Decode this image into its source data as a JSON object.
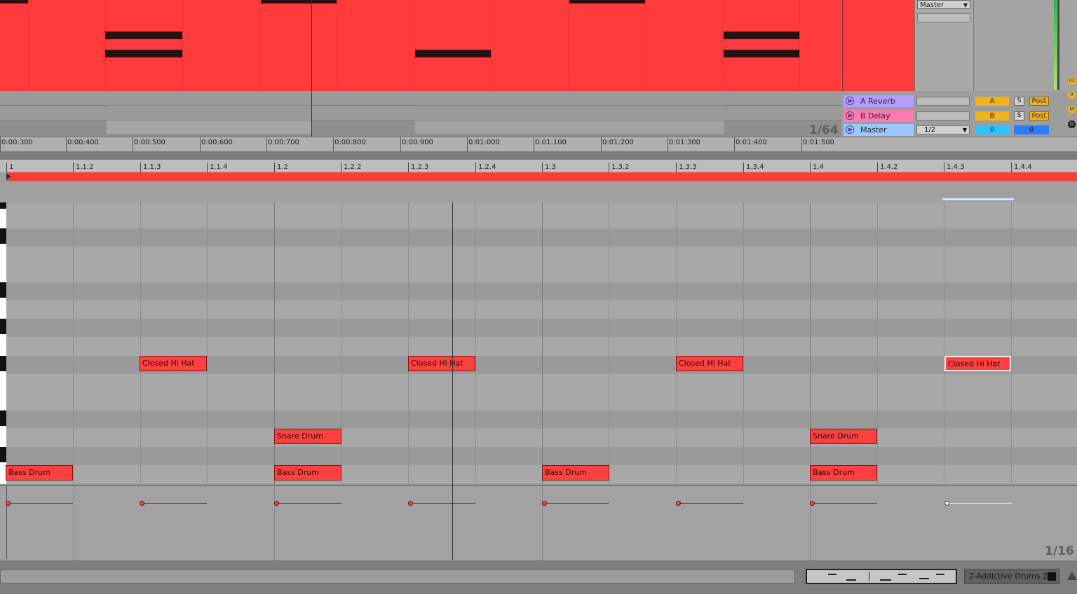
{
  "io": {
    "output_select": "Master"
  },
  "returns": [
    {
      "name": "A Reverb",
      "send": "A",
      "solo": "S",
      "post": "Post",
      "color": "#b59cff",
      "send_color": "#f2b21c"
    },
    {
      "name": "B Delay",
      "send": "B",
      "solo": "S",
      "post": "Post",
      "color": "#ff7ab0",
      "send_color": "#f2b21c"
    },
    {
      "name": "Master",
      "select": "1/2",
      "pan": "0",
      "vol": "0",
      "color": "#9ec6ff",
      "send_color": "#2bc4ff"
    }
  ],
  "side_buttons": [
    "IO",
    "R",
    "M",
    "D"
  ],
  "overview": {
    "zoom_label": "1/64"
  },
  "time_ruler": [
    "0:00:300",
    "0:00:400",
    "0:00:500",
    "0:00:600",
    "0:00:700",
    "0:00:800",
    "0:00:900",
    "0:01:000",
    "0:01:100",
    "0:01:200",
    "0:01:300",
    "0:01:400",
    "0:01:500"
  ],
  "beat_ruler": [
    "1",
    "1.1.2",
    "1.1.3",
    "1.1.4",
    "1.2",
    "1.2.2",
    "1.2.3",
    "1.2.4",
    "1.3",
    "1.3.2",
    "1.3.3",
    "1.3.4",
    "1.4",
    "1.4.2",
    "1.4.3",
    "1.4.4"
  ],
  "notes": {
    "hat": "Closed Hi Hat",
    "snare": "Snare Drum",
    "kick": "Bass Drum"
  },
  "grid": {
    "zoom_label": "1/16"
  },
  "bottom": {
    "track_name": "2-Addictive Drums 2"
  },
  "colors": {
    "clip": "#ff3a3a",
    "note": "#ff4040"
  }
}
